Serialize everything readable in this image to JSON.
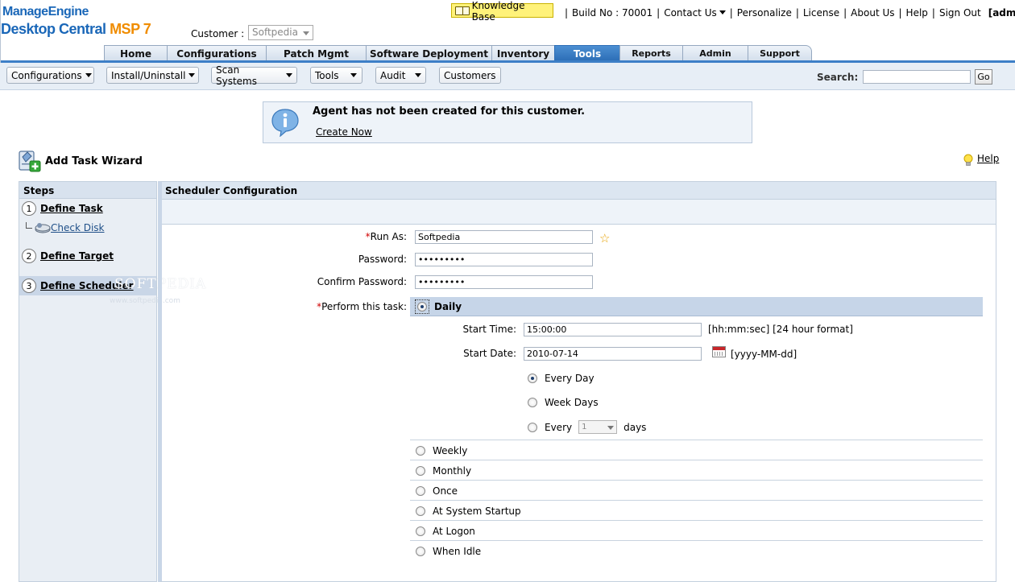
{
  "brand": {
    "company": "ManageEngine",
    "product": "Desktop Central",
    "edition": "MSP 7",
    "colors": {
      "primary": "#1a67b8",
      "accent": "#f08c00"
    }
  },
  "customer": {
    "label": "Customer :",
    "value": "Softpedia"
  },
  "toplinks": {
    "knowledge_base": "Knowledge Base",
    "build": "Build No : 70001",
    "contact_us": "Contact Us",
    "personalize": "Personalize",
    "license": "License",
    "about_us": "About Us",
    "help": "Help",
    "sign_out": "Sign Out",
    "user": "[admin]"
  },
  "tabs": [
    {
      "label": "Home"
    },
    {
      "label": "Configurations"
    },
    {
      "label": "Patch Mgmt"
    },
    {
      "label": "Software Deployment"
    },
    {
      "label": "Inventory"
    },
    {
      "label": "Tools",
      "active": true
    },
    {
      "label": "Reports"
    },
    {
      "label": "Admin"
    },
    {
      "label": "Support"
    }
  ],
  "subtoolbar": {
    "items": [
      "Configurations",
      "Install/Uninstall",
      "Scan Systems",
      "Tools",
      "Audit",
      "Customers"
    ],
    "search_label": "Search:",
    "search_value": "",
    "go_label": "Go"
  },
  "notice": {
    "icon": "info-icon",
    "message": "Agent has not been created for this customer.",
    "link": "Create Now"
  },
  "wizard": {
    "title": "Add Task Wizard",
    "help": "Help"
  },
  "steps": {
    "header": "Steps",
    "items": [
      {
        "num": "1",
        "label": "Define Task"
      },
      {
        "num": "2",
        "label": "Define Target"
      },
      {
        "num": "3",
        "label": "Define Scheduler",
        "current": true
      }
    ],
    "sub_item": "Check Disk",
    "watermark": "SOFTPEDIA",
    "watermark_url": "www.softpedia.com"
  },
  "scheduler": {
    "title": "Scheduler Configuration",
    "run_as_label": "Run As:",
    "run_as_value": "Softpedia",
    "password_label": "Password:",
    "password_value": "•••••••••",
    "confirm_label": "Confirm Password:",
    "confirm_value": "•••••••••",
    "perform_label": "Perform this task:",
    "required_mark": "*",
    "daily": "Daily",
    "start_time_label": "Start Time:",
    "start_time_value": "15:00:00",
    "start_time_hint": "[hh:mm:sec] [24 hour format]",
    "start_date_label": "Start Date:",
    "start_date_value": "2010-07-14",
    "start_date_hint": "[yyyy-MM-dd]",
    "daily_options": {
      "every_day": "Every Day",
      "week_days": "Week Days",
      "every": "Every",
      "every_value": "1",
      "days": "days",
      "selected": "Every Day"
    },
    "other_options": [
      "Weekly",
      "Monthly",
      "Once",
      "At System Startup",
      "At Logon",
      "When Idle"
    ],
    "selected_option": "Daily"
  }
}
